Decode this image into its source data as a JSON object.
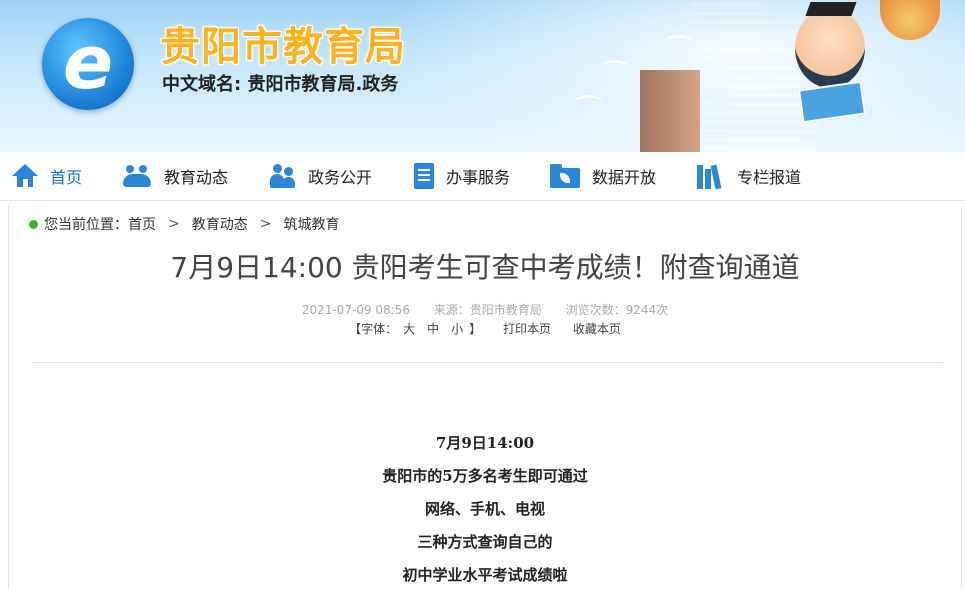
{
  "header": {
    "site_title": "贵阳市教育局",
    "domain_line": "中文域名: 贵阳市教育局.政务"
  },
  "nav": {
    "items": [
      {
        "label": "首页",
        "icon": "home-icon"
      },
      {
        "label": "教育动态",
        "icon": "people-icon"
      },
      {
        "label": "政务公开",
        "icon": "group-icon"
      },
      {
        "label": "办事服务",
        "icon": "document-icon"
      },
      {
        "label": "数据开放",
        "icon": "folder-icon"
      },
      {
        "label": "专栏报道",
        "icon": "books-icon"
      }
    ]
  },
  "breadcrumb": {
    "prefix": "您当前位置：",
    "items": [
      "首页",
      "教育动态",
      "筑城教育"
    ],
    "separator": ">"
  },
  "article": {
    "title": "7月9日14:00 贵阳考生可查中考成绩！附查询通道",
    "date": "2021-07-09 08:56",
    "source": "来源：贵阳市教育局",
    "views": "浏览次数：9244次",
    "font_label_open": "【字体：",
    "font_sizes": [
      "大",
      "中",
      "小"
    ],
    "font_label_close": "】",
    "print": "打印本页",
    "favorite": "收藏本页",
    "lines": [
      "7月9日14:00",
      "贵阳市的5万多名考生即可通过",
      "网络、手机、电视",
      "三种方式查询自己的",
      "初中学业水平考试成绩啦"
    ]
  },
  "colors": {
    "accent": "#2a87d8",
    "title_orange": "#ffb21f",
    "breadcrumb_dot": "#3cb02a"
  }
}
